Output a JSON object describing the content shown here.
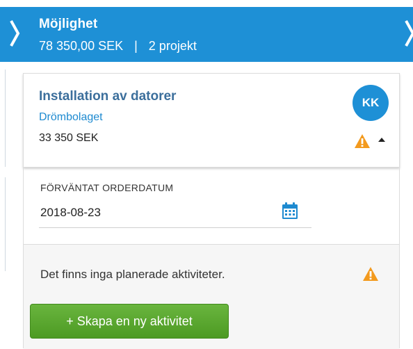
{
  "header": {
    "title": "Möjlighet",
    "amount": "78 350,00 SEK",
    "separator": "|",
    "projects": "2 projekt",
    "prev_icon": "chevron-left-icon",
    "next_icon": "chevron-right-icon"
  },
  "card": {
    "title": "Installation av datorer",
    "company": "Drömbolaget",
    "amount": "33 350 SEK",
    "avatar_initials": "KK",
    "warning_icon": "warning-icon",
    "toggle_icon": "caret-up-icon"
  },
  "order": {
    "label": "FÖRVÄNTAT ORDERDATUM",
    "date": "2018-08-23",
    "calendar_icon": "calendar-icon"
  },
  "activities": {
    "empty_text": "Det finns inga planerade aktiviteter.",
    "warning_icon": "warning-icon",
    "create_button": "+ Skapa en ny aktivitet"
  },
  "colors": {
    "header_bg": "#1e90d6",
    "title_blue": "#3c6f9c",
    "link_blue": "#1e8ad0",
    "warning": "#f39a1e",
    "button_green": "#5aa72f"
  }
}
